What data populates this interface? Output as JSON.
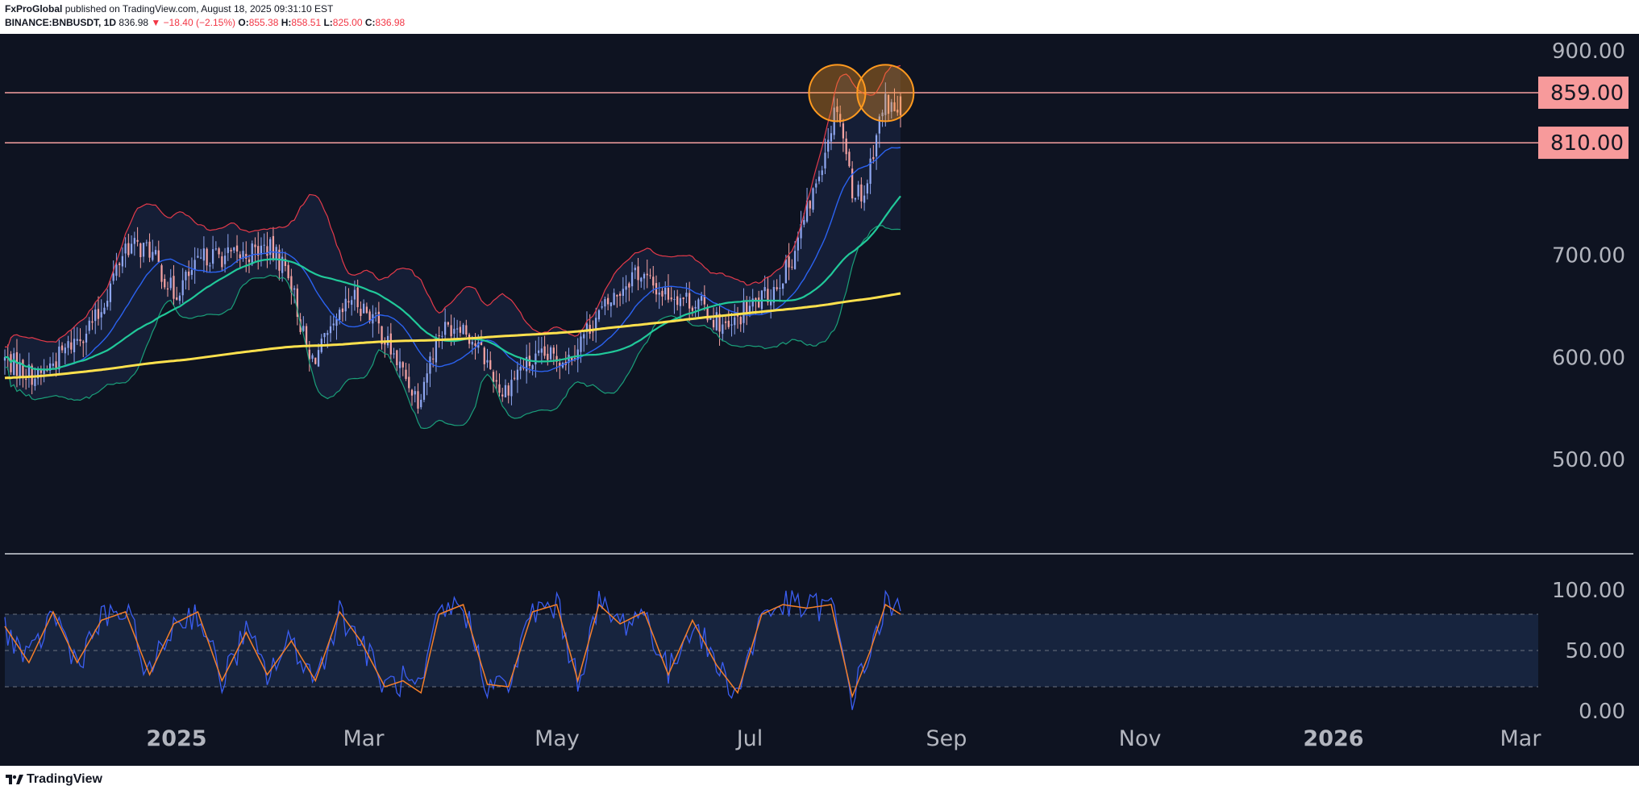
{
  "header": {
    "publisher": "FxProGlobal",
    "published_text": "published on TradingView.com, August 18, 2025 09:31:10 EST",
    "symbol": "BINANCE:BNBUSDT, 1D",
    "last": "836.98",
    "change": "▼ −18.40 (−2.15%)",
    "o_label": "O:",
    "o": "855.38",
    "h_label": "H:",
    "h": "858.51",
    "l_label": "L:",
    "l": "825.00",
    "c_label": "C:",
    "c": "836.98"
  },
  "footer": {
    "logo_text": "TradingView"
  },
  "colors": {
    "background": "#0e1321",
    "up": "#8ea6f0",
    "down": "#f5a3a3",
    "level_line": "#f6a0a0",
    "badge": "#f79a9b",
    "ma200": "#ffe14d",
    "ma50": "#21c99a",
    "ma20": "#2b62f0",
    "bb_upper": "#e33a4a",
    "bb_lower": "#1a9f7a",
    "circle": "#ff9a1f",
    "stoch_k": "#3a5df0",
    "stoch_d": "#f57f2a"
  },
  "chart_data": {
    "type": "candlestick",
    "price_axis": {
      "ticks": [
        "900.00",
        "700.00",
        "600.00",
        "500.00"
      ],
      "range": [
        430,
        920
      ]
    },
    "levels": [
      {
        "label": "859.00",
        "value": 859
      },
      {
        "label": "810.00",
        "value": 810
      }
    ],
    "highlighted_tops": [
      {
        "date": "2025-07-28",
        "price": 861
      },
      {
        "date": "2025-08-13",
        "price": 861
      }
    ],
    "time_axis": [
      {
        "label": "2025",
        "major": true
      },
      {
        "label": "Mar",
        "major": false
      },
      {
        "label": "May",
        "major": false
      },
      {
        "label": "Jul",
        "major": false
      },
      {
        "label": "Sep",
        "major": false
      },
      {
        "label": "Nov",
        "major": false
      },
      {
        "label": "2026",
        "major": true
      },
      {
        "label": "Mar",
        "major": false
      }
    ],
    "price_path": [
      [
        "2024-10-25",
        598
      ],
      [
        "2024-11-05",
        580
      ],
      [
        "2024-11-15",
        610
      ],
      [
        "2024-11-25",
        640
      ],
      [
        "2024-12-04",
        710
      ],
      [
        "2024-12-12",
        705
      ],
      [
        "2024-12-20",
        662
      ],
      [
        "2024-12-31",
        700
      ],
      [
        "2025-01-10",
        698
      ],
      [
        "2025-01-20",
        708
      ],
      [
        "2025-01-27",
        685
      ],
      [
        "2025-02-03",
        595
      ],
      [
        "2025-02-10",
        620
      ],
      [
        "2025-02-17",
        660
      ],
      [
        "2025-02-24",
        640
      ],
      [
        "2025-03-05",
        590
      ],
      [
        "2025-03-11",
        560
      ],
      [
        "2025-03-18",
        625
      ],
      [
        "2025-03-25",
        635
      ],
      [
        "2025-04-02",
        600
      ],
      [
        "2025-04-08",
        565
      ],
      [
        "2025-04-14",
        590
      ],
      [
        "2025-04-22",
        600
      ],
      [
        "2025-04-30",
        600
      ],
      [
        "2025-05-08",
        635
      ],
      [
        "2025-05-14",
        655
      ],
      [
        "2025-05-22",
        685
      ],
      [
        "2025-05-30",
        665
      ],
      [
        "2025-06-06",
        660
      ],
      [
        "2025-06-13",
        650
      ],
      [
        "2025-06-22",
        625
      ],
      [
        "2025-06-27",
        645
      ],
      [
        "2025-07-05",
        660
      ],
      [
        "2025-07-12",
        690
      ],
      [
        "2025-07-20",
        760
      ],
      [
        "2025-07-28",
        850
      ],
      [
        "2025-08-02",
        765
      ],
      [
        "2025-08-06",
        760
      ],
      [
        "2025-08-10",
        820
      ],
      [
        "2025-08-13",
        850
      ],
      [
        "2025-08-18",
        837
      ]
    ],
    "stochastic": {
      "axis_ticks": [
        "100.00",
        "50.00",
        "0.00"
      ],
      "band_upper": 80,
      "band_lower": 20,
      "d_path": [
        [
          "2024-10-25",
          70
        ],
        [
          "2024-11-02",
          40
        ],
        [
          "2024-11-10",
          82
        ],
        [
          "2024-11-18",
          40
        ],
        [
          "2024-11-26",
          75
        ],
        [
          "2024-12-04",
          82
        ],
        [
          "2024-12-12",
          30
        ],
        [
          "2024-12-20",
          72
        ],
        [
          "2024-12-28",
          82
        ],
        [
          "2025-01-05",
          25
        ],
        [
          "2025-01-13",
          65
        ],
        [
          "2025-01-20",
          30
        ],
        [
          "2025-01-28",
          58
        ],
        [
          "2025-02-05",
          25
        ],
        [
          "2025-02-13",
          82
        ],
        [
          "2025-02-20",
          58
        ],
        [
          "2025-02-28",
          20
        ],
        [
          "2025-03-06",
          25
        ],
        [
          "2025-03-12",
          15
        ],
        [
          "2025-03-18",
          80
        ],
        [
          "2025-03-26",
          88
        ],
        [
          "2025-04-03",
          22
        ],
        [
          "2025-04-10",
          20
        ],
        [
          "2025-04-18",
          82
        ],
        [
          "2025-04-26",
          88
        ],
        [
          "2025-05-03",
          25
        ],
        [
          "2025-05-10",
          88
        ],
        [
          "2025-05-17",
          72
        ],
        [
          "2025-05-25",
          82
        ],
        [
          "2025-06-02",
          30
        ],
        [
          "2025-06-10",
          75
        ],
        [
          "2025-06-18",
          38
        ],
        [
          "2025-06-25",
          15
        ],
        [
          "2025-07-03",
          80
        ],
        [
          "2025-07-10",
          88
        ],
        [
          "2025-07-18",
          85
        ],
        [
          "2025-07-26",
          88
        ],
        [
          "2025-08-02",
          12
        ],
        [
          "2025-08-08",
          50
        ],
        [
          "2025-08-13",
          88
        ],
        [
          "2025-08-18",
          80
        ]
      ]
    }
  }
}
